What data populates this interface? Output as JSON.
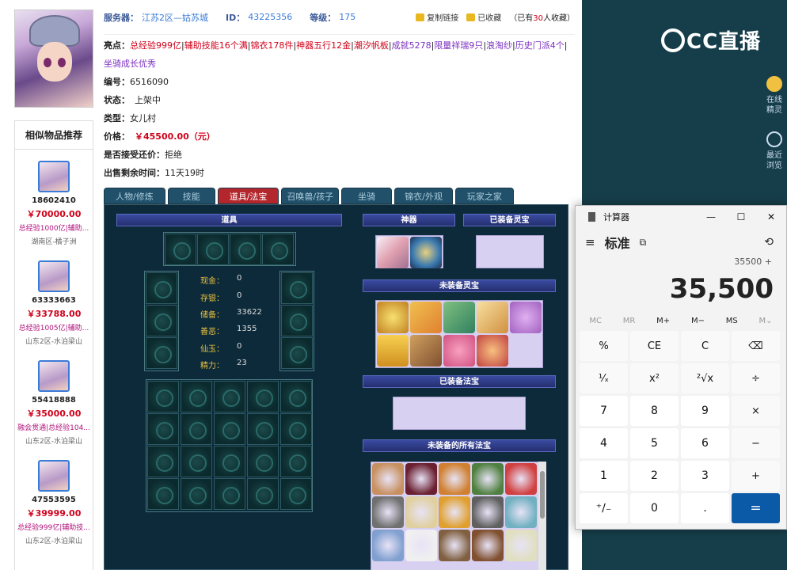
{
  "header": {
    "server_label": "服务器：",
    "server_value": "江苏2区—姑苏城",
    "id_label": "ID：",
    "id_value": "43225356",
    "level_label": "等级：",
    "level_value": "175",
    "copy_link": "复制链接",
    "favorited": "已收藏",
    "fav_count_prefix": "（已有",
    "fav_count": "30",
    "fav_count_suffix": "人收藏）"
  },
  "details": {
    "highlights_label": "亮点：",
    "highlights": [
      {
        "text": "总经验999亿",
        "color": "red"
      },
      {
        "text": "辅助技能16个满",
        "color": "red"
      },
      {
        "text": "锦衣178件",
        "color": "red"
      },
      {
        "text": "神器五行12金",
        "color": "red"
      },
      {
        "text": "潮汐帆板",
        "color": "red"
      },
      {
        "text": "成就5278",
        "color": "purple"
      },
      {
        "text": "限量祥瑞9只",
        "color": "purple"
      },
      {
        "text": "浪淘纱",
        "color": "purple"
      },
      {
        "text": "历史门派4个",
        "color": "purple"
      },
      {
        "text": "坐骑成长优秀",
        "color": "purple"
      }
    ],
    "number_label": "编号：",
    "number_value": "6516090",
    "status_label": "状态：",
    "status_value": "上架中",
    "type_label": "类型：",
    "type_value": "女儿村",
    "price_label": "价格：",
    "price_value": "￥45500.00（元）",
    "bargain_label": "是否接受还价：",
    "bargain_value": "拒绝",
    "remain_label": "出售剩余时间：",
    "remain_value": "11天19时"
  },
  "tabs": [
    "人物/修炼",
    "技能",
    "道具/法宝",
    "召唤兽/孩子",
    "坐骑",
    "锦衣/外观",
    "玩家之家"
  ],
  "active_tab": 2,
  "panel": {
    "items_title": "道具",
    "artifact_title": "神器",
    "equipped_spirit_title": "已装备灵宝",
    "unequipped_spirit_title": "未装备灵宝",
    "equipped_treasure_title": "已装备法宝",
    "unequipped_treasure_title": "未装备的所有法宝",
    "stats": [
      {
        "k": "现金：",
        "v": "0"
      },
      {
        "k": "存银：",
        "v": "0"
      },
      {
        "k": "储备：",
        "v": "33622"
      },
      {
        "k": "善恶：",
        "v": "1355"
      },
      {
        "k": "仙玉：",
        "v": "0"
      },
      {
        "k": "精力：",
        "v": "23"
      }
    ]
  },
  "similar": {
    "title": "相似物品推荐",
    "items": [
      {
        "id": "18602410",
        "price": "￥70000.00",
        "desc": "总经验1000亿|辅助...",
        "server": "湖南区-橘子洲"
      },
      {
        "id": "63333663",
        "price": "￥33788.00",
        "desc": "总经验1005亿|辅助...",
        "server": "山东2区-水泊梁山"
      },
      {
        "id": "55418888",
        "price": "￥35000.00",
        "desc": "融会贯通|总经验104...",
        "server": "山东2区-水泊梁山"
      },
      {
        "id": "47553595",
        "price": "￥39999.00",
        "desc": "总经验999亿|辅助技...",
        "server": "山东2区-水泊梁山"
      }
    ]
  },
  "sidebar": {
    "logo": "CC直播",
    "buttons": [
      {
        "label1": "在线",
        "label2": "精灵",
        "icon": "sprite-icon"
      },
      {
        "label1": "最近",
        "label2": "浏览",
        "icon": "clock-icon"
      }
    ]
  },
  "calculator": {
    "title": "计算器",
    "mode": "标准",
    "expression": "35500 +",
    "display": "35,500",
    "memory": [
      "MC",
      "MR",
      "M+",
      "M−",
      "MS",
      "M⌄"
    ],
    "keys": [
      "%",
      "CE",
      "C",
      "⌫",
      "¹⁄ₓ",
      "x²",
      "²√x",
      "÷",
      "7",
      "8",
      "9",
      "×",
      "4",
      "5",
      "6",
      "−",
      "1",
      "2",
      "3",
      "+",
      "⁺∕₋",
      "0",
      ".",
      "="
    ]
  }
}
